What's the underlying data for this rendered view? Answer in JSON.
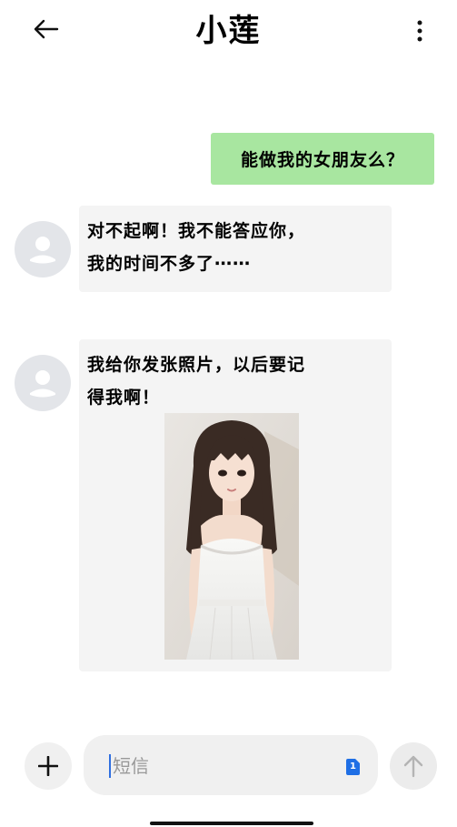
{
  "header": {
    "back_icon": "arrow-left-icon",
    "title": "小莲",
    "more_icon": "more-vertical-icon"
  },
  "messages": [
    {
      "direction": "outgoing",
      "text": "能做我的女朋友么？"
    },
    {
      "direction": "incoming",
      "lines": [
        "对不起啊！我不能答应你，",
        "我的时间不多了⋯⋯"
      ]
    },
    {
      "direction": "incoming",
      "lines": [
        "我给你发张照片，以后要记",
        "得我啊！"
      ],
      "has_photo": true
    }
  ],
  "composer": {
    "add_icon": "plus-icon",
    "placeholder": "短信",
    "sim_badge": "1",
    "send_icon": "arrow-up-icon"
  },
  "colors": {
    "outgoing_bubble": "#a8e6a0",
    "incoming_bubble": "#f4f4f4",
    "avatar_bg": "#e3e5e9",
    "sim_badge": "#1f6fe5"
  }
}
